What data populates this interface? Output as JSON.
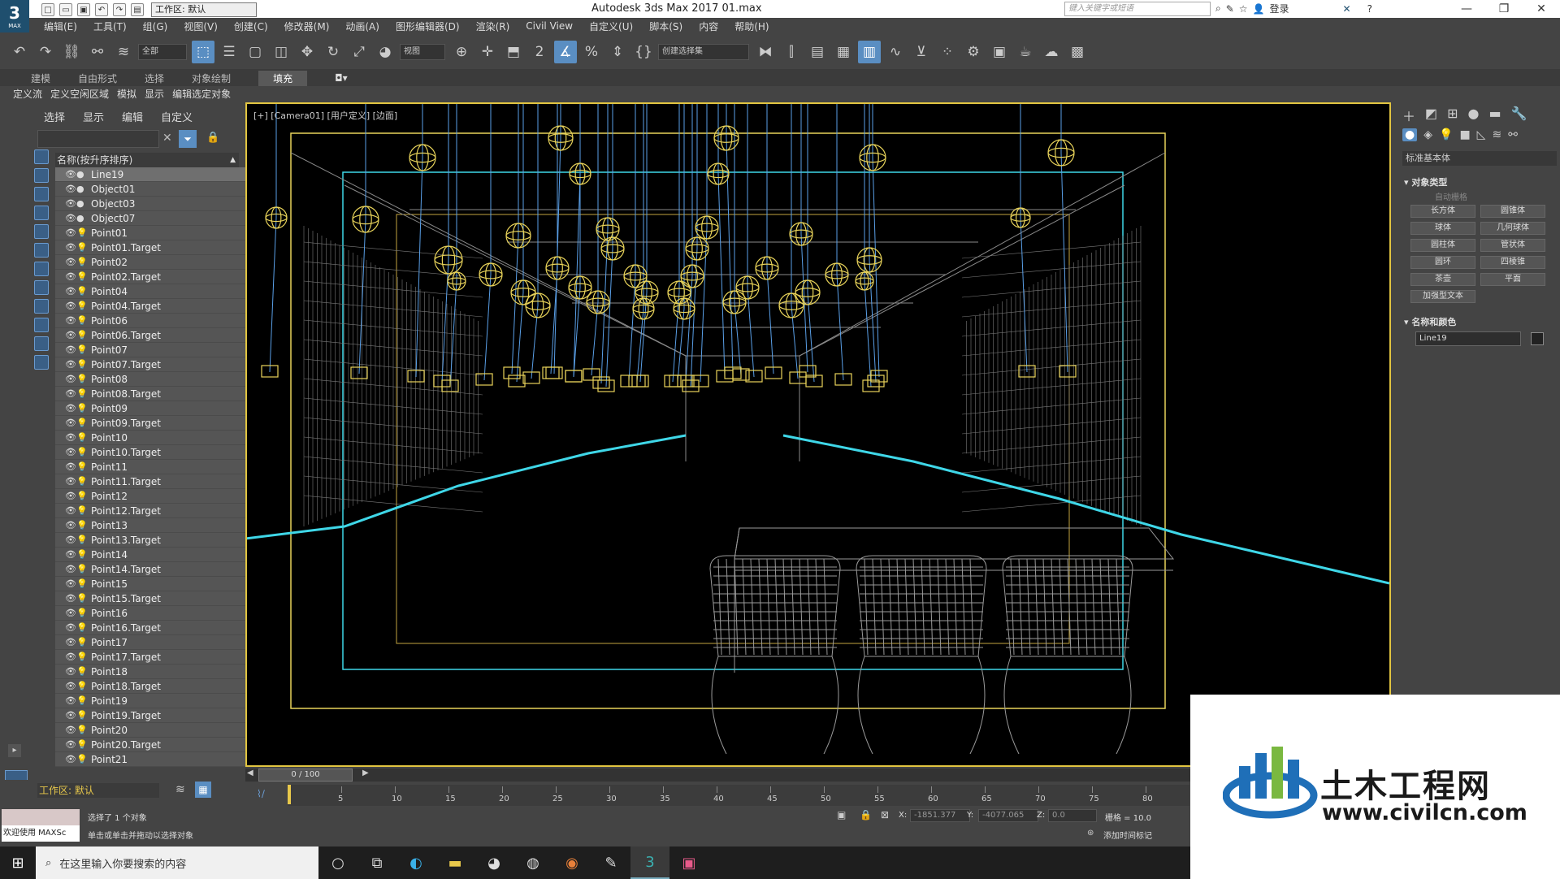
{
  "titlebar": {
    "logo": "3",
    "logo_sub": "MAX",
    "workspace_label": "工作区: 默认",
    "app_title": "Autodesk 3ds Max 2017     01.max",
    "search_placeholder": "键入关键字或短语",
    "login": "登录",
    "minimize": "—",
    "maximize": "❐",
    "close": "✕"
  },
  "menu": [
    "编辑(E)",
    "工具(T)",
    "组(G)",
    "视图(V)",
    "创建(C)",
    "修改器(M)",
    "动画(A)",
    "图形编辑器(D)",
    "渲染(R)",
    "Civil View",
    "自定义(U)",
    "脚本(S)",
    "内容",
    "帮助(H)"
  ],
  "toolbar": {
    "filter_value": "全部",
    "view_value": "视图",
    "selection_set": "创建选择集"
  },
  "ribbon_tabs": [
    "建模",
    "自由形式",
    "选择",
    "对象绘制",
    "填充"
  ],
  "ribbon_active": "填充",
  "ribbon_sub": [
    "定义流",
    "定义空闲区域",
    "模拟",
    "显示",
    "编辑选定对象"
  ],
  "explorer": {
    "tabs": [
      "选择",
      "显示",
      "编辑",
      "自定义"
    ],
    "header": "名称(按升序排序)",
    "rows": [
      "Line19",
      "Object01",
      "Object03",
      "Object07",
      "Point01",
      "Point01.Target",
      "Point02",
      "Point02.Target",
      "Point04",
      "Point04.Target",
      "Point06",
      "Point06.Target",
      "Point07",
      "Point07.Target",
      "Point08",
      "Point08.Target",
      "Point09",
      "Point09.Target",
      "Point10",
      "Point10.Target",
      "Point11",
      "Point11.Target",
      "Point12",
      "Point12.Target",
      "Point13",
      "Point13.Target",
      "Point14",
      "Point14.Target",
      "Point15",
      "Point15.Target",
      "Point16",
      "Point16.Target",
      "Point17",
      "Point17.Target",
      "Point18",
      "Point18.Target",
      "Point19",
      "Point19.Target",
      "Point20",
      "Point20.Target",
      "Point21"
    ],
    "selected": "Line19",
    "workspace": "工作区: 默认"
  },
  "viewport": {
    "label": "[+] [Camera01] [用户定义] [边面]"
  },
  "cmdpanel": {
    "dropdown": "标准基本体",
    "section_object_type": "对象类型",
    "autogrid": "自动栅格",
    "buttons": [
      "长方体",
      "圆锥体",
      "球体",
      "几何球体",
      "圆柱体",
      "管状体",
      "圆环",
      "四棱锥",
      "茶壶",
      "平面",
      "加强型文本"
    ],
    "section_name_color": "名称和颜色",
    "name_value": "Line19"
  },
  "timeline": {
    "frame_display": "0 / 100",
    "ticks": [
      "5",
      "10",
      "15",
      "20",
      "25",
      "30",
      "35",
      "40",
      "45",
      "50",
      "55",
      "60",
      "65",
      "70",
      "75",
      "80"
    ]
  },
  "status": {
    "welcome": "欢迎使用 MAXSc",
    "line1": "选择了 1 个对象",
    "line2": "单击或单击并拖动以选择对象",
    "x_label": "X:",
    "x_value": "-1851.377",
    "y_label": "Y:",
    "y_value": "-4077.065",
    "z_label": "Z:",
    "z_value": "0.0",
    "grid": "栅格 = 10.0",
    "add_time_tag": "添加时间标记"
  },
  "taskbar": {
    "search": "在这里输入你要搜索的内容"
  },
  "watermark": {
    "title": "土木工程网",
    "url": "www.civilcn.com"
  },
  "colors": {
    "viewport_border": "#e2c541",
    "wire_yellow": "#e8d35a",
    "wire_cyan": "#3fd7e8",
    "wire_gray": "#9a9a9a",
    "accent": "#5a8ec2"
  }
}
